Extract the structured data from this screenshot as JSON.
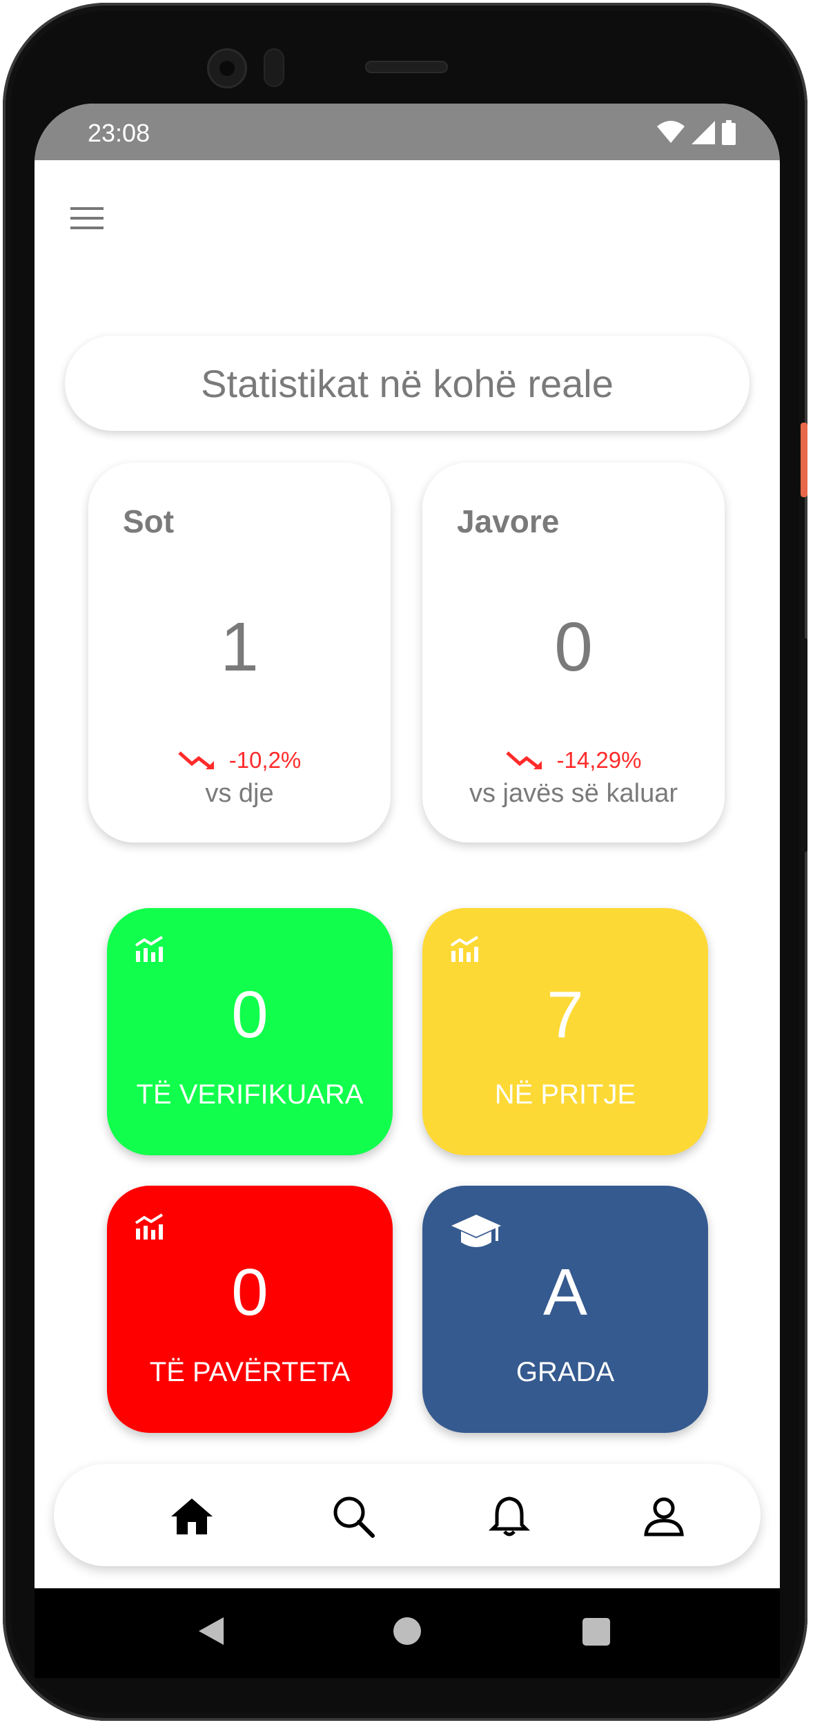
{
  "status_bar": {
    "time": "23:08",
    "icons": [
      "wifi-icon",
      "signal-icon",
      "battery-icon"
    ]
  },
  "header": {
    "title": "Statistikat në kohë reale"
  },
  "stats": {
    "today": {
      "title": "Sot",
      "value": "1",
      "change": "-10,2%",
      "comparison": "vs dje",
      "trend": "down"
    },
    "weekly": {
      "title": "Javore",
      "value": "0",
      "change": "-14,29%",
      "comparison": "vs javës së kaluar",
      "trend": "down"
    }
  },
  "tiles": {
    "verified": {
      "value": "0",
      "label": "TË VERIFIKUARA",
      "color": "#11ff4c",
      "icon": "chart-icon"
    },
    "pending": {
      "value": "7",
      "label": "NË PRITJE",
      "color": "#fdd935",
      "icon": "chart-icon"
    },
    "false": {
      "value": "0",
      "label": "TË PAVËRTETA",
      "color": "#ff0000",
      "icon": "chart-icon"
    },
    "grade": {
      "value": "A",
      "label": "GRADA",
      "color": "#355a8f",
      "icon": "graduation-cap-icon"
    }
  },
  "colors": {
    "trend_down": "#ff2a2a",
    "text_gray": "#7a7a7a",
    "status_bar": "#888888"
  },
  "bottom_nav": {
    "items": [
      "home-icon",
      "search-icon",
      "bell-icon",
      "user-icon"
    ]
  }
}
